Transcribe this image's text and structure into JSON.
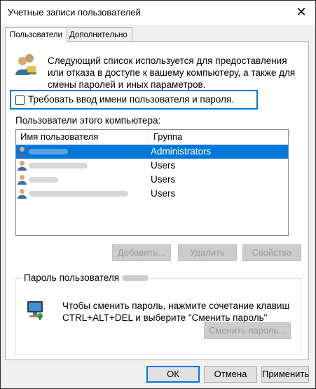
{
  "window": {
    "title": "Учетные записи пользователей",
    "close_glyph": "✕"
  },
  "tabs": [
    {
      "label": "Пользователи",
      "active": true
    },
    {
      "label": "Дополнительно",
      "active": false
    }
  ],
  "description": "Следующий список используется для предоставления или отказа в доступе к вашему компьютеру, а также для смены паролей и иных параметров.",
  "require_login": {
    "label": "Требовать ввод имени пользователя и пароля.",
    "checked": false
  },
  "users_list": {
    "caption": "Пользователи этого компьютера:",
    "columns": [
      "Имя пользователя",
      "Группа"
    ],
    "rows": [
      {
        "group": "Administrators",
        "selected": true
      },
      {
        "group": "Users",
        "selected": false
      },
      {
        "group": "Users",
        "selected": false
      },
      {
        "group": "Users",
        "selected": false
      }
    ]
  },
  "list_buttons": {
    "add": "Добавить...",
    "remove": "Удалить",
    "properties": "Свойства"
  },
  "password_group": {
    "title": "Пароль пользователя",
    "text": "Чтобы сменить пароль, нажмите сочетание клавиш CTRL+ALT+DEL и выберите \"Сменить пароль\"",
    "change_button": "Сменить пароль..."
  },
  "footer": {
    "ok": "ОК",
    "cancel": "Отмена",
    "apply": "Применить"
  },
  "icons": {
    "users": "users-icon",
    "user_row": "user-icon",
    "computer": "computer-key-icon"
  },
  "colors": {
    "accent": "#0078d7",
    "window_bg": "#f0f0f0",
    "panel_bg": "#ffffff"
  }
}
